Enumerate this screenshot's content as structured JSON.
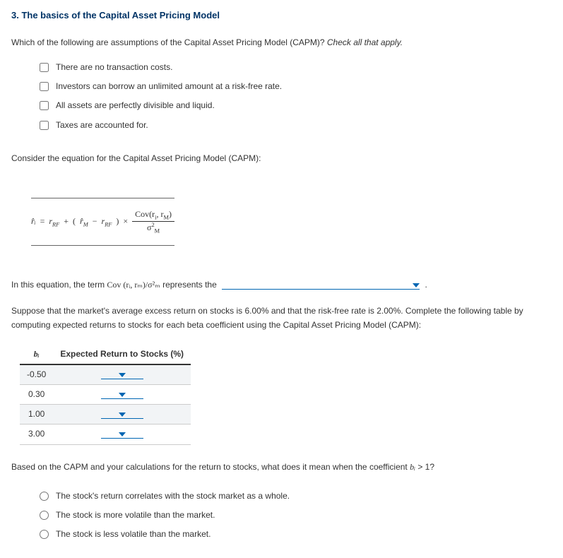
{
  "title": "3. The basics of the Capital Asset Pricing Model",
  "q1_intro_a": "Which of the following are assumptions of the Capital Asset Pricing Model (CAPM)? ",
  "q1_intro_b": "Check all that apply.",
  "checks": [
    "There are no transaction costs.",
    "Investors can borrow an unlimited amount at a risk-free rate.",
    "All assets are perfectly divisible and liquid.",
    "Taxes are accounted for."
  ],
  "consider": "Consider the equation for the Capital Asset Pricing Model (CAPM):",
  "eq": {
    "lhs": "r̂ᵢ",
    "eqsign": "=",
    "r_rf1": "r",
    "rf_sub1": "RF",
    "plus": "+",
    "lp": "(",
    "rm_hat": "r̂",
    "m_sub": "M",
    "minus": "−",
    "r_rf2": "r",
    "rf_sub2": "RF",
    "rp": ")",
    "times": "×",
    "cov_num_a": "Cov(r",
    "cov_num_b": "i",
    "cov_num_c": ", r",
    "cov_num_d": "M",
    "cov_num_e": ")",
    "den_a": "σ",
    "den_b": "2",
    "den_c": "M"
  },
  "q2_a": "In this equation, the term ",
  "q2_term": "Cov (rᵢ, rₘ)/σ²ₘ",
  "q2_b": " represents the ",
  "q2_c": " .",
  "suppose": "Suppose that the market's average excess return on stocks is 6.00% and that the risk-free rate is 2.00%. Complete the following table by computing expected returns to stocks for each beta coefficient using the Capital Asset Pricing Model (CAPM):",
  "table": {
    "h1": "bᵢ",
    "h2": "Expected Return to Stocks (%)",
    "rows": [
      "-0.50",
      "0.30",
      "1.00",
      "3.00"
    ]
  },
  "q3_a": "Based on the CAPM and your calculations for the return to stocks, what does it mean when the coefficient ",
  "q3_b": "bᵢ",
  "q3_c": " > 1?",
  "radios": [
    "The stock's return correlates with the stock market as a whole.",
    "The stock is more volatile than the market.",
    "The stock is less volatile than the market."
  ]
}
